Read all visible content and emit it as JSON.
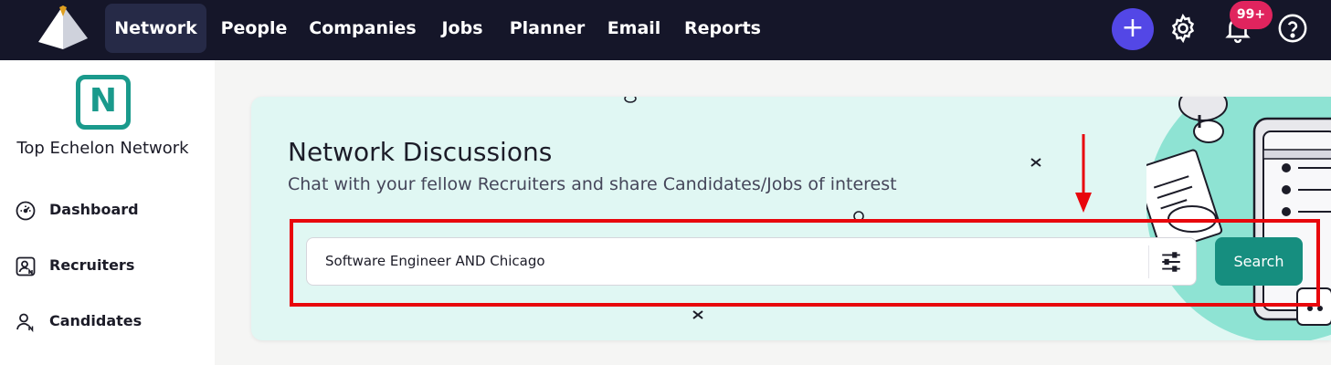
{
  "nav": {
    "items": [
      {
        "label": "Network",
        "active": true
      },
      {
        "label": "People"
      },
      {
        "label": "Companies"
      },
      {
        "label": "Jobs"
      },
      {
        "label": "Planner"
      },
      {
        "label": "Email"
      },
      {
        "label": "Reports"
      }
    ],
    "add_label": "+",
    "notification_badge": "99+"
  },
  "sidebar": {
    "logo_letter": "N",
    "title": "Top Echelon Network",
    "items": [
      {
        "label": "Dashboard",
        "icon": "dashboard-icon"
      },
      {
        "label": "Recruiters",
        "icon": "recruiters-icon"
      },
      {
        "label": "Candidates",
        "icon": "candidates-icon"
      }
    ]
  },
  "hero": {
    "title": "Network Discussions",
    "subtitle": "Chat with your fellow Recruiters and share Candidates/Jobs of interest",
    "search_value": "Software Engineer AND Chicago",
    "search_button": "Search"
  },
  "colors": {
    "topbar": "#151629",
    "accent": "#168e7f",
    "card_bg": "#e0f7f3",
    "plus_button": "#5347e6",
    "badge": "#e0245e",
    "annotation": "#e8060c"
  }
}
